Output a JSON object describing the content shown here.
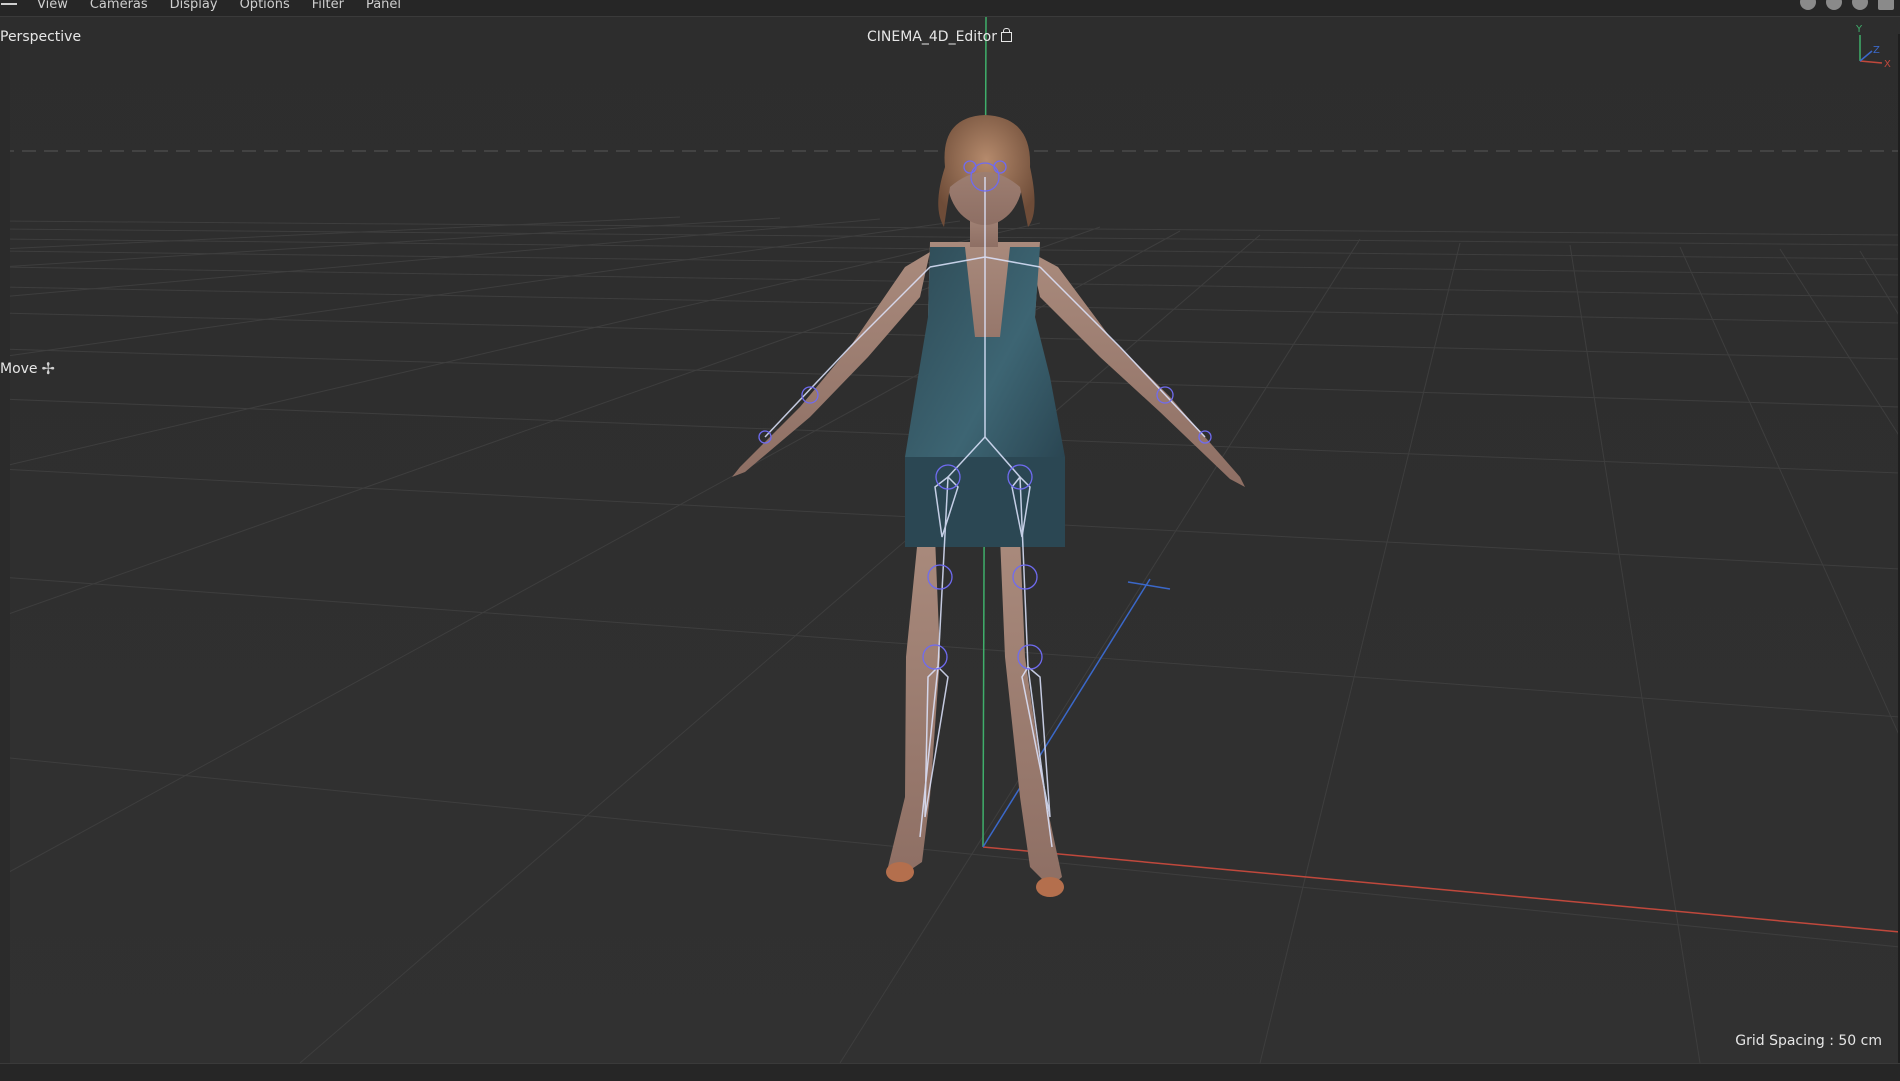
{
  "menu": {
    "items": [
      "View",
      "Cameras",
      "Display",
      "Options",
      "Filter",
      "Panel"
    ]
  },
  "viewport": {
    "view_name": "Perspective",
    "camera_name": "CINEMA_4D_Editor",
    "tool_label": "Move",
    "grid_spacing": "Grid Spacing : 50 cm"
  },
  "gizmo": {
    "y": "Y",
    "z": "Z",
    "x": "X"
  },
  "colors": {
    "background": "#2f2f2f",
    "grid": "#3d3d3d",
    "x_axis": "#c0483c",
    "y_axis": "#3fae6a",
    "z_axis": "#3b68c9"
  }
}
